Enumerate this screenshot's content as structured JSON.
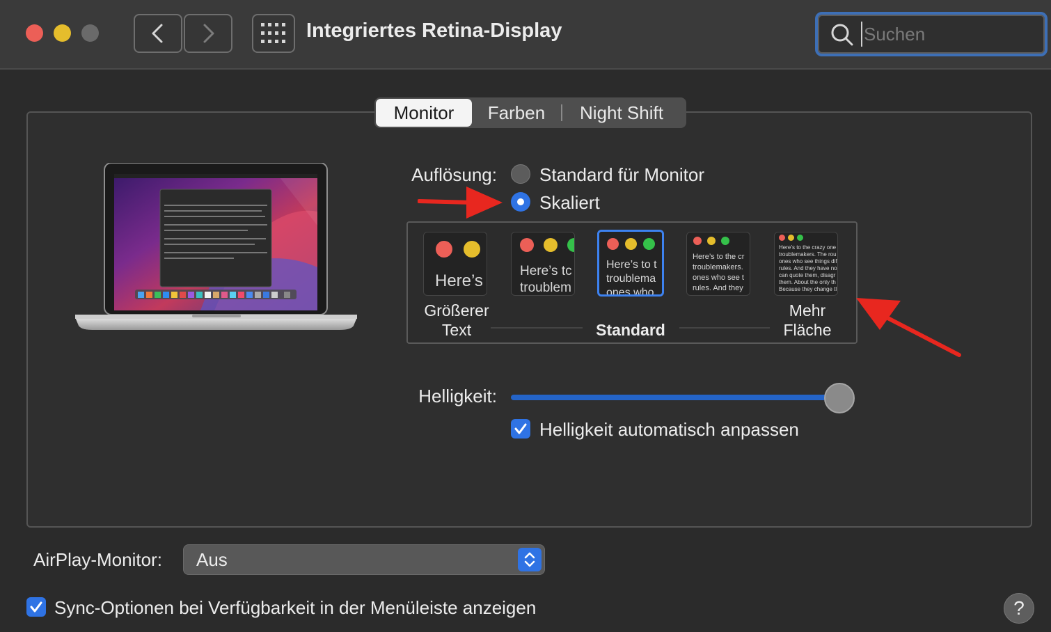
{
  "window": {
    "title": "Integriertes Retina-Display",
    "search_placeholder": "Suchen"
  },
  "tabs": [
    {
      "label": "Monitor",
      "active": true
    },
    {
      "label": "Farben",
      "active": false
    },
    {
      "label": "Night Shift",
      "active": false
    }
  ],
  "resolution": {
    "label": "Auflösung:",
    "options": [
      {
        "label": "Standard für Monitor",
        "selected": false
      },
      {
        "label": "Skaliert",
        "selected": true
      }
    ]
  },
  "scale": {
    "selected_index": 2,
    "captions": {
      "left_line1": "Größerer",
      "left_line2": "Text",
      "center": "Standard",
      "right_line1": "Mehr",
      "right_line2": "Fläche"
    },
    "previews": {
      "p1": "Here’s",
      "p2_l1": "Here’s tc",
      "p2_l2": "troublem",
      "p3_l1": "Here’s to t",
      "p3_l2": "troublema",
      "p3_l3": "ones who",
      "p4_l1": "Here’s to the cr",
      "p4_l2": "troublemakers.",
      "p4_l3": "ones who see t",
      "p4_l4": "rules. And they",
      "p5_l1": "Here’s to the crazy one",
      "p5_l2": "troublemakers. The rou",
      "p5_l3": "ones who see things dif",
      "p5_l4": "rules. And they have no",
      "p5_l5": "can quote them, disagr",
      "p5_l6": "them. About the only th",
      "p5_l7": "Because they change tl"
    }
  },
  "brightness": {
    "label": "Helligkeit:",
    "value": 1.0,
    "auto_label": "Helligkeit automatisch anpassen",
    "auto_checked": true
  },
  "airplay": {
    "label": "AirPlay-Monitor:",
    "value": "Aus"
  },
  "sync": {
    "label": "Sync-Optionen bei Verfügbarkeit in der Menüleiste anzeigen",
    "checked": true
  },
  "help": {
    "label": "?"
  },
  "colors": {
    "accent": "#2f73e4",
    "arrow": "#e8271f",
    "traffic_red": "#ec5f57",
    "traffic_yellow": "#e5bd2c",
    "traffic_green": "#35c14a"
  }
}
